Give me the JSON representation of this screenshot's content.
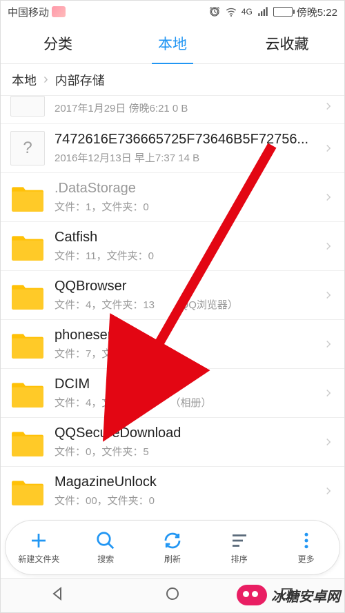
{
  "status": {
    "carrier": "中国移动",
    "time": "傍晚5:22",
    "signal_type": "4G"
  },
  "tabs": [
    {
      "label": "分类",
      "active": false
    },
    {
      "label": "本地",
      "active": true
    },
    {
      "label": "云收藏",
      "active": false
    }
  ],
  "breadcrumb": {
    "root": "本地",
    "path": "内部存储"
  },
  "items": [
    {
      "type": "file-partial",
      "name": "",
      "meta": "2017年1月29日 傍晚6:21 0 B"
    },
    {
      "type": "file",
      "name": "7472616E736665725F73646B5F72756...",
      "meta": "2016年12月13日 早上7:37 14 B"
    },
    {
      "type": "folder-hidden",
      "name": ".DataStorage",
      "meta": "文件：1，文件夹：0"
    },
    {
      "type": "folder",
      "name": "Catfish",
      "meta": "文件：11，文件夹：0"
    },
    {
      "type": "folder",
      "name": "QQBrowser",
      "meta": "文件：4，文件夹：13　　（QQ浏览器）"
    },
    {
      "type": "folder",
      "name": "phoneservice",
      "meta": "文件：7，文件夹：0"
    },
    {
      "type": "folder",
      "name": "DCIM",
      "meta": "文件：4，文件夹：10　　（相册）"
    },
    {
      "type": "folder",
      "name": "QQSecureDownload",
      "meta": "文件：0，文件夹：5"
    },
    {
      "type": "folder-partial",
      "name": "MagazineUnlock",
      "meta": "文件：00，文件夹：0"
    }
  ],
  "toolbar": {
    "new_folder": "新建文件夹",
    "search": "搜索",
    "refresh": "刷新",
    "sort": "排序",
    "more": "更多"
  },
  "watermark_text": "冰糖安卓网"
}
